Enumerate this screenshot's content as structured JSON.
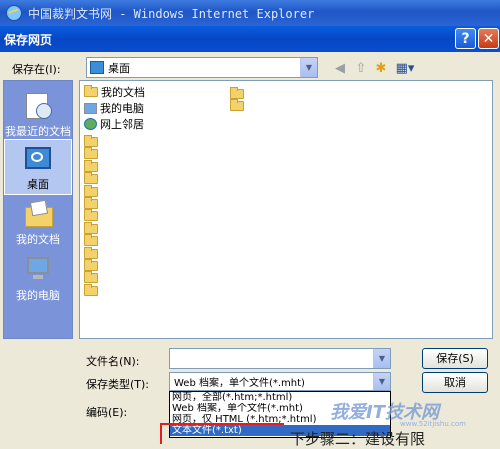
{
  "browser": {
    "title": "中国裁判文书网 - Windows Internet Explorer"
  },
  "dialog": {
    "title": "保存网页",
    "help_glyph": "?",
    "close_glyph": "✕"
  },
  "save_in": {
    "label": "保存在(I):",
    "value": "桌面"
  },
  "toolbar": {
    "icons": [
      "back-icon",
      "up-folder-icon",
      "new-folder-icon",
      "view-menu-icon"
    ],
    "glyphs": {
      "back": "◀",
      "up": "⇧",
      "new_folder": "✱",
      "view": "▦▾"
    }
  },
  "places": [
    {
      "label": "我最近的文档",
      "icon": "recent-documents-icon"
    },
    {
      "label": "桌面",
      "icon": "desktop-icon",
      "selected": true
    },
    {
      "label": "我的文档",
      "icon": "my-documents-icon"
    },
    {
      "label": "我的电脑",
      "icon": "my-computer-icon"
    }
  ],
  "files": {
    "special": [
      {
        "label": "我的文档",
        "icon": "my-documents-icon"
      },
      {
        "label": "我的电脑",
        "icon": "my-computer-icon"
      },
      {
        "label": "网上邻居",
        "icon": "network-places-icon"
      }
    ],
    "folder_count_left": 13,
    "folder_count_right": 2
  },
  "filename": {
    "label": "文件名(N):",
    "value": ""
  },
  "filetype": {
    "label": "保存类型(T):",
    "value": "Web 档案，单个文件(*.mht)"
  },
  "encoding": {
    "label": "编码(E):"
  },
  "buttons": {
    "save": "保存(S)",
    "cancel": "取消"
  },
  "filetype_options": [
    {
      "label": "网页，全部(*.htm;*.html)",
      "selected": false
    },
    {
      "label": "Web 档案，单个文件(*.mht)",
      "selected": false
    },
    {
      "label": "网页，仅 HTML (*.htm;*.html)",
      "selected": false
    },
    {
      "label": "文本文件(*.txt)",
      "selected": true
    }
  ],
  "watermark": {
    "main": "我爱IT技术网",
    "sub": "www.52itjishu.com"
  },
  "bottom_text": "下步骤二：建设有限"
}
